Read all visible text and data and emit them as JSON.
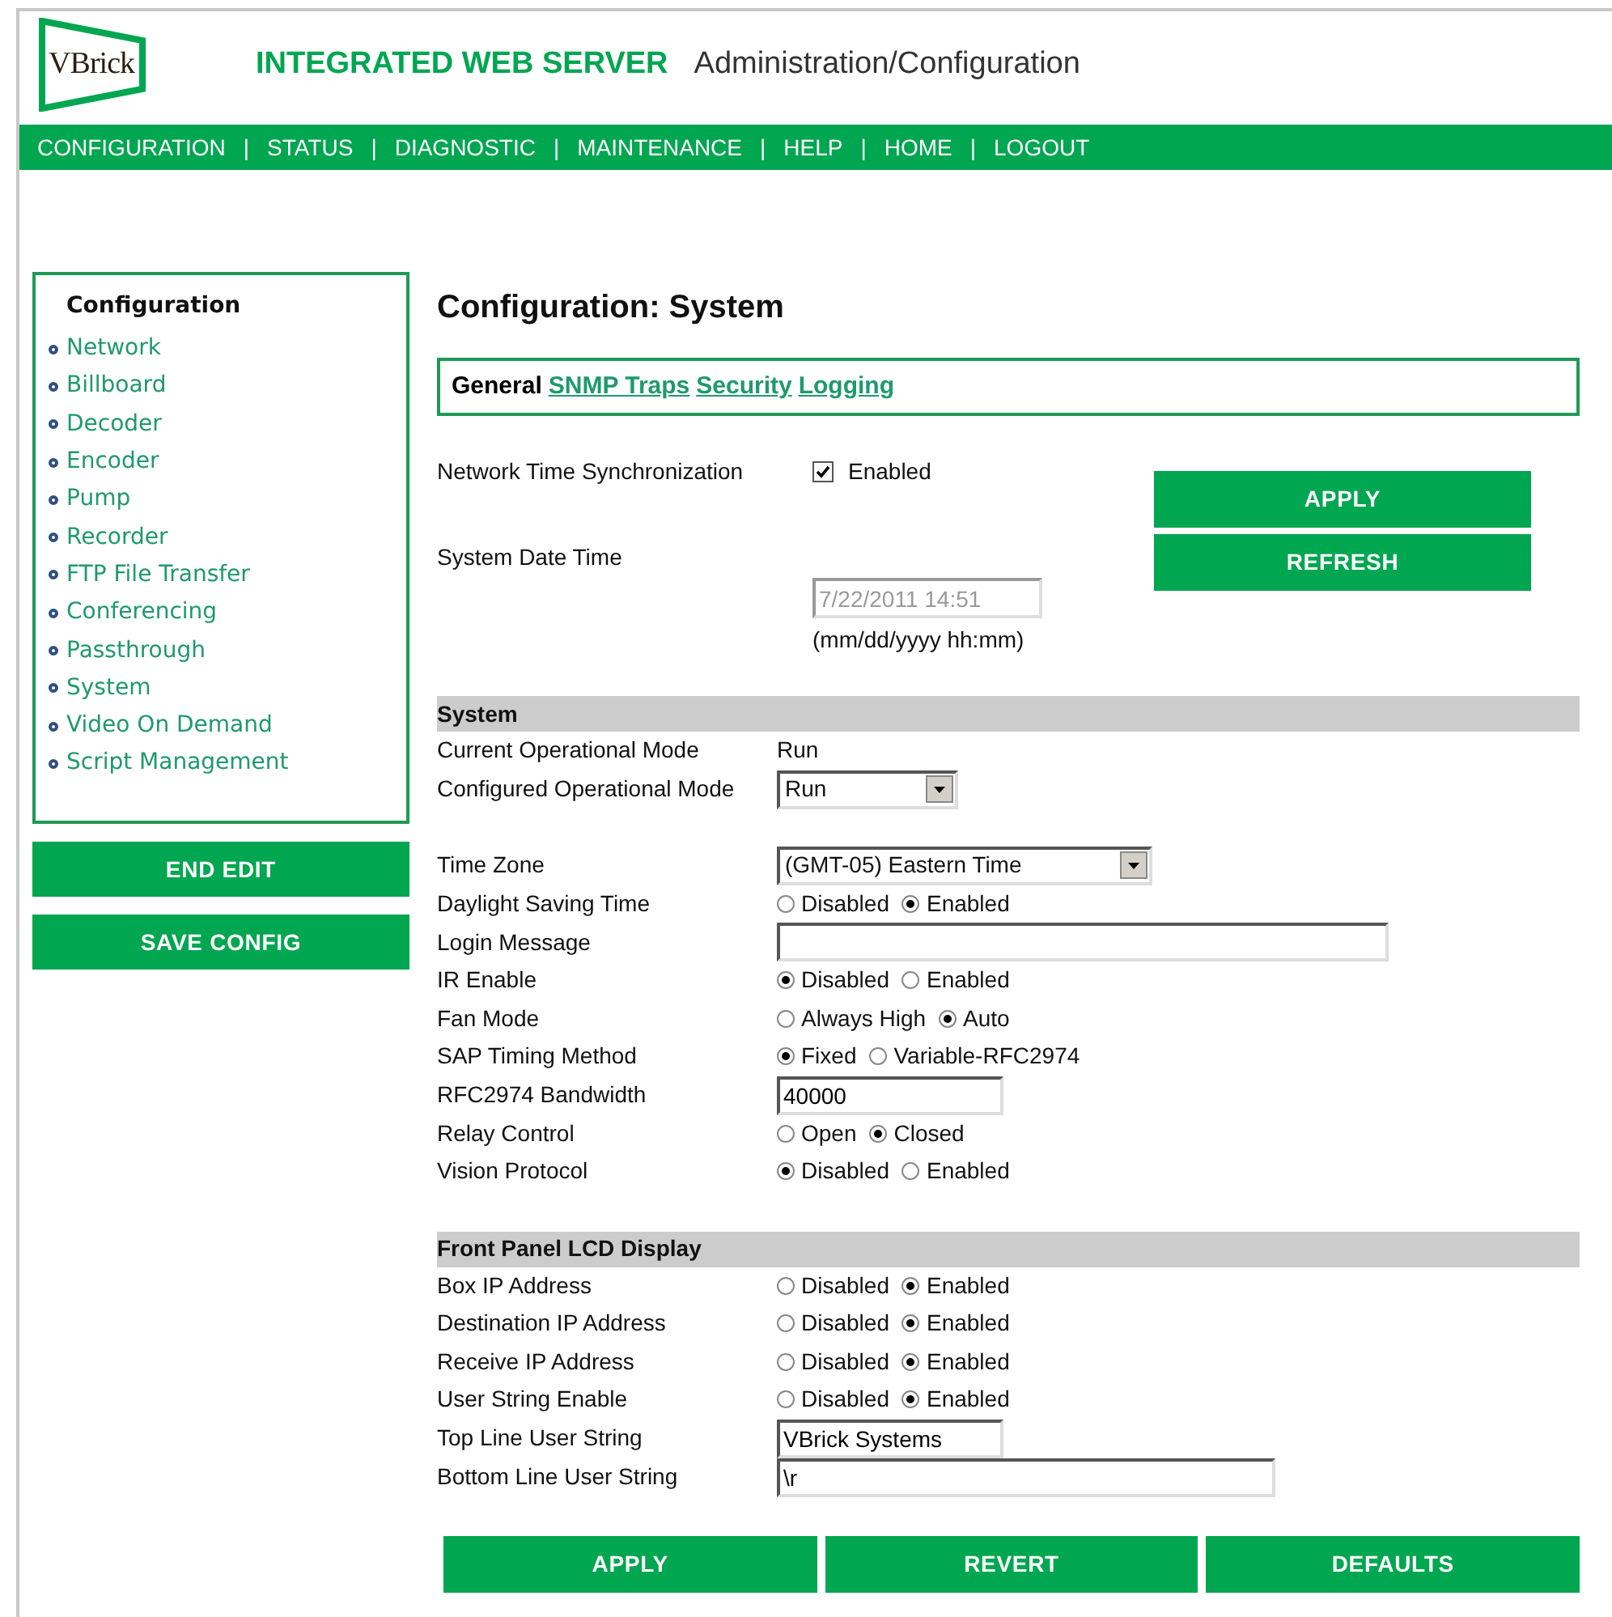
{
  "header": {
    "logo_text": "VBrick",
    "title": "INTEGRATED WEB SERVER",
    "subtitle": "Administration/Configuration"
  },
  "nav": {
    "items": [
      "CONFIGURATION",
      "STATUS",
      "DIAGNOSTIC",
      "MAINTENANCE",
      "HELP",
      "HOME",
      "LOGOUT"
    ],
    "separator": "|"
  },
  "sidebar": {
    "title": "Configuration",
    "items": [
      {
        "label": "Network",
        "selected": false
      },
      {
        "label": "Billboard",
        "selected": false
      },
      {
        "label": "Decoder",
        "selected": false
      },
      {
        "label": "Encoder",
        "selected": false
      },
      {
        "label": "Pump",
        "selected": false
      },
      {
        "label": "Recorder",
        "selected": false
      },
      {
        "label": "FTP File Transfer",
        "selected": false
      },
      {
        "label": "Conferencing",
        "selected": false
      },
      {
        "label": "Passthrough",
        "selected": false
      },
      {
        "label": "System",
        "selected": false
      },
      {
        "label": "Video On Demand",
        "selected": false
      },
      {
        "label": "Script Management",
        "selected": false
      }
    ],
    "buttons": [
      "END EDIT",
      "SAVE CONFIG"
    ]
  },
  "page_title": "Configuration: System",
  "tabs": [
    {
      "label": "General",
      "selected": true
    },
    {
      "label": "SNMP Traps",
      "selected": false
    },
    {
      "label": "Security",
      "selected": false
    },
    {
      "label": "Logging",
      "selected": false
    }
  ],
  "time": {
    "sync_label": "Network Time Synchronization",
    "sync_option": "Enabled",
    "sync_checked": true,
    "date_label": "System Date Time",
    "date_value": "7/22/2011 14:51",
    "date_disabled": true,
    "date_hint": "(mm/dd/yyyy hh:mm)",
    "buttons": [
      "APPLY",
      "REFRESH"
    ]
  },
  "sections": [
    {
      "title": "System",
      "rows": [
        {
          "label": "Current Operational Mode",
          "kind": "text",
          "value": "Run"
        },
        {
          "label": "Configured Operational Mode",
          "kind": "select",
          "value": "Run"
        },
        {
          "label": "Time Zone",
          "kind": "select",
          "value": "(GMT-05) Eastern Time"
        },
        {
          "label": "Daylight Saving Time",
          "kind": "radio",
          "options": [
            {
              "label": "Disabled",
              "selected": false
            },
            {
              "label": "Enabled",
              "selected": true
            }
          ]
        },
        {
          "label": "Login Message",
          "kind": "input"
        },
        {
          "label": "IR Enable",
          "kind": "radio",
          "options": [
            {
              "label": "Disabled",
              "selected": true
            },
            {
              "label": "Enabled",
              "selected": false
            }
          ]
        },
        {
          "label": "Fan Mode",
          "kind": "radio",
          "options": [
            {
              "label": "Always High",
              "selected": false
            },
            {
              "label": "Auto",
              "selected": true
            }
          ]
        },
        {
          "label": "SAP Timing Method",
          "kind": "radio",
          "options": [
            {
              "label": "Fixed",
              "selected": true
            },
            {
              "label": "Variable-RFC2974",
              "selected": false
            }
          ]
        },
        {
          "label": "RFC2974 Bandwidth",
          "kind": "input",
          "value": "40000"
        },
        {
          "label": "Relay Control",
          "kind": "radio",
          "options": [
            {
              "label": "Open",
              "selected": false
            },
            {
              "label": "Closed",
              "selected": true
            }
          ]
        },
        {
          "label": "Vision Protocol",
          "kind": "radio",
          "options": [
            {
              "label": "Disabled",
              "selected": true
            },
            {
              "label": "Enabled",
              "selected": false
            }
          ]
        }
      ]
    },
    {
      "title": "Front Panel LCD Display",
      "rows": [
        {
          "label": "Box IP Address",
          "kind": "radio",
          "options": [
            {
              "label": "Disabled",
              "selected": false
            },
            {
              "label": "Enabled",
              "selected": true
            }
          ]
        },
        {
          "label": "Destination IP Address",
          "kind": "radio",
          "options": [
            {
              "label": "Disabled",
              "selected": false
            },
            {
              "label": "Enabled",
              "selected": true
            }
          ]
        },
        {
          "label": "Receive IP Address",
          "kind": "radio",
          "options": [
            {
              "label": "Disabled",
              "selected": false
            },
            {
              "label": "Enabled",
              "selected": true
            }
          ]
        },
        {
          "label": "User String Enable",
          "kind": "radio",
          "options": [
            {
              "label": "Disabled",
              "selected": false
            },
            {
              "label": "Enabled",
              "selected": true
            }
          ]
        },
        {
          "label": "Top Line User String",
          "kind": "input",
          "value": "VBrick Systems"
        },
        {
          "label": "Bottom Line User String",
          "kind": "input",
          "value": "\\r"
        }
      ]
    }
  ],
  "footer_buttons": [
    "APPLY",
    "REVERT",
    "DEFAULTS"
  ]
}
